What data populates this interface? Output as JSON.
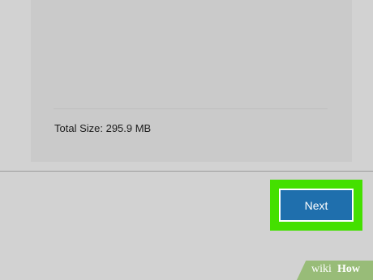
{
  "installer": {
    "total_size_label": "Total Size: 295.9 MB",
    "next_label": "Next"
  },
  "watermark": {
    "part1": "wiki",
    "part2": "How"
  },
  "colors": {
    "highlight": "#44e000",
    "button": "#1f6fad",
    "background": "#d2d2d2"
  }
}
